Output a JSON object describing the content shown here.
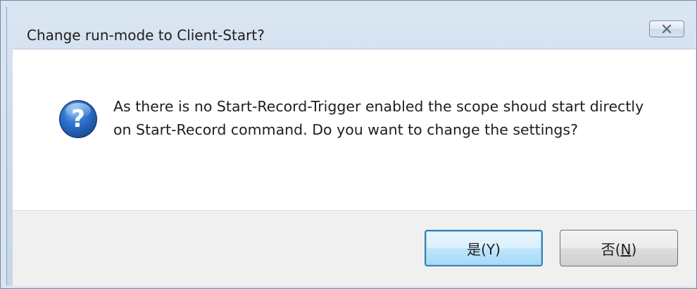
{
  "dialog": {
    "title": "Change run-mode to Client-Start?",
    "close_icon": "close-icon",
    "message_icon": "question-icon",
    "message": "As there is no Start-Record-Trigger enabled the scope shoud start directly on Start-Record command. Do you want to change the settings?",
    "buttons": {
      "yes_label_main": "是(",
      "yes_accel": "Y",
      "yes_label_end": ")",
      "no_label_main": "否(",
      "no_accel": "N",
      "no_label_end": ")"
    }
  }
}
